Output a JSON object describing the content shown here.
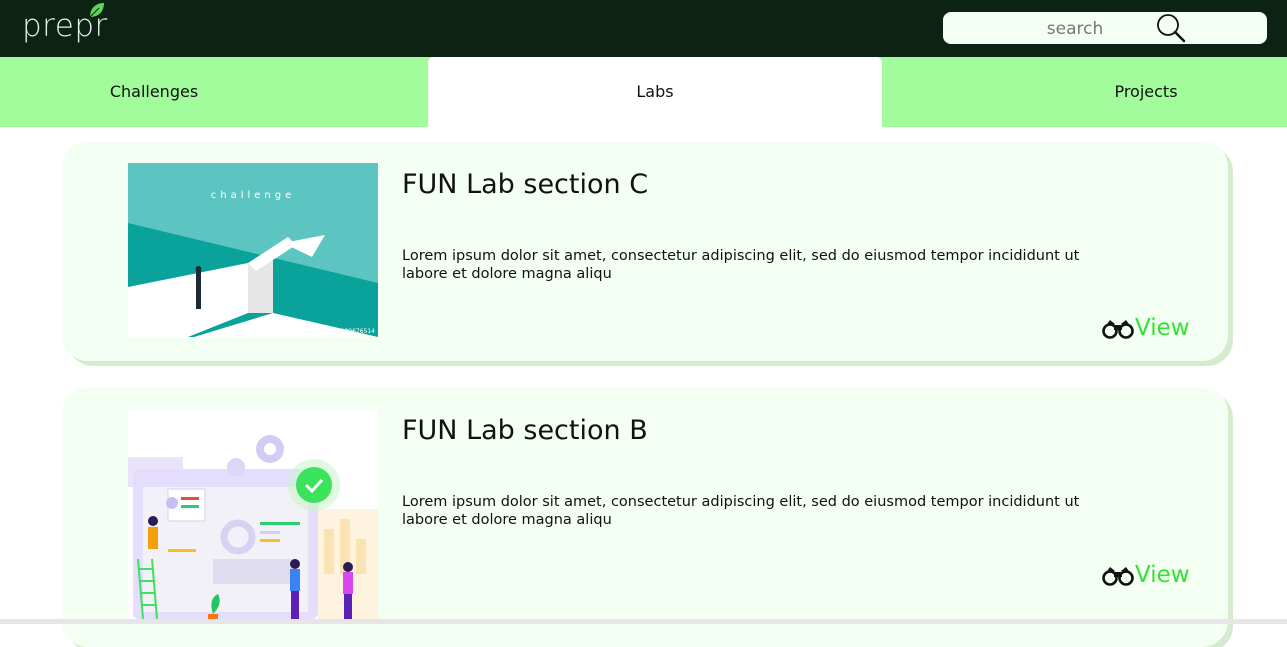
{
  "header": {
    "logo_text": "prepr",
    "search": {
      "placeholder": "search",
      "value": ""
    }
  },
  "tabs": [
    {
      "label": "Challenges",
      "active": false
    },
    {
      "label": "Labs",
      "active": true
    },
    {
      "label": "Projects",
      "active": false
    }
  ],
  "cards": [
    {
      "title": "FUN Lab section C",
      "description": "Lorem ipsum dolor sit amet, consectetur adipiscing elit, sed do eiusmod tempor incididunt ut labore et dolore magna aliqu",
      "image_caption": "challenge",
      "image_id": "#189676514",
      "view_label": "View",
      "view_icon": "binoculars-icon"
    },
    {
      "title": "FUN Lab section B",
      "description": "Lorem ipsum dolor sit amet, consectetur adipiscing elit, sed do eiusmod tempor incididunt ut labore et dolore magna aliqu",
      "view_label": "View",
      "view_icon": "binoculars-icon"
    }
  ],
  "colors": {
    "topbar": "#0c2314",
    "tab_bar": "#a2fc9c",
    "card_bg": "#f4fff3",
    "view_link": "#33e233",
    "search_bg": "#f4fff4"
  }
}
